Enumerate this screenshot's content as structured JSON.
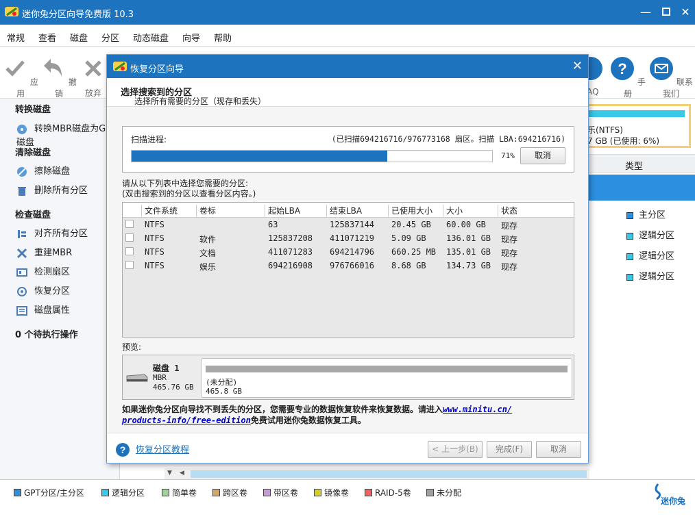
{
  "window": {
    "title": "迷你兔分区向导免费版 10.3"
  },
  "menu": [
    "常规",
    "查看",
    "磁盘",
    "分区",
    "动态磁盘",
    "向导",
    "帮助"
  ],
  "toolbar": {
    "apply": "应用",
    "undo": "撤销",
    "discard": "放弃",
    "faq": "FAQ",
    "manual": "手册",
    "contact": "联系我们"
  },
  "sidebar": {
    "convert_header": "转换磁盘",
    "convert_item": "转换MBR磁盘为GPT磁盘",
    "clean_header": "清除磁盘",
    "wipe": "擦除磁盘",
    "delete_all": "删除所有分区",
    "check_header": "检查磁盘",
    "align": "对齐所有分区",
    "rebuild_mbr": "重建MBR",
    "surface": "检测扇区",
    "recover": "恢复分区",
    "props": "磁盘属性",
    "pending": "0 个待执行操作"
  },
  "right": {
    "disk_label": "乐(NTFS)",
    "disk_usage": "7 GB (已使用: 6%)",
    "col_type": "类型",
    "types": [
      "主分区",
      "逻辑分区",
      "逻辑分区",
      "逻辑分区"
    ],
    "type_colors": [
      "#2d8fe0",
      "#38c8e8",
      "#38c8e8",
      "#38c8e8"
    ]
  },
  "dialog": {
    "title": "恢复分区向导",
    "heading": "选择搜索到的分区",
    "subheading": "选择所有需要的分区（现存和丢失）",
    "scan_label": "扫描进程:",
    "scan_status": "(已扫描694216716/976773168 扇区。扫描 LBA:694216716)",
    "progress": 0.71,
    "progress_text": "71%",
    "cancel_scan": "取消",
    "instruction1": "请从以下列表中选择您需要的分区:",
    "instruction2": "(双击搜索到的分区以查看分区内容。)",
    "columns": [
      "文件系统",
      "卷标",
      "起始LBA",
      "结束LBA",
      "已使用大小",
      "大小",
      "状态"
    ],
    "rows": [
      {
        "fs": "NTFS",
        "label": "",
        "start": "63",
        "end": "125837144",
        "used": "20.45 GB",
        "size": "60.00 GB",
        "status": "现存"
      },
      {
        "fs": "NTFS",
        "label": "软件",
        "start": "125837208",
        "end": "411071219",
        "used": "5.09 GB",
        "size": "136.01 GB",
        "status": "现存"
      },
      {
        "fs": "NTFS",
        "label": "文档",
        "start": "411071283",
        "end": "694214796",
        "used": "660.25 MB",
        "size": "135.01 GB",
        "status": "现存"
      },
      {
        "fs": "NTFS",
        "label": "娱乐",
        "start": "694216908",
        "end": "976766016",
        "used": "8.68 GB",
        "size": "134.73 GB",
        "status": "现存"
      }
    ],
    "preview_label": "预览:",
    "disk_name": "磁盘 1",
    "disk_type": "MBR",
    "disk_size": "465.76 GB",
    "seg_label": "(未分配)",
    "seg_size": "465.8 GB",
    "notice_text": "如果迷你兔分区向导找不到丢失的分区，您需要专业的数据恢复软件来恢复数据。请进入",
    "notice_link1": "www.minitu.cn/",
    "notice_link2": "products-info/free-edition",
    "notice_tail": "免费试用迷你兔数据恢复工具。",
    "tutorial": "恢复分区教程",
    "back": "< 上一步(B)",
    "finish": "完成(F)",
    "cancel": "取消"
  },
  "legend": [
    {
      "label": "GPT分区/主分区",
      "color": "#2d8fe0"
    },
    {
      "label": "逻辑分区",
      "color": "#38c8e8"
    },
    {
      "label": "简单卷",
      "color": "#9ed49a"
    },
    {
      "label": "跨区卷",
      "color": "#d2a868"
    },
    {
      "label": "带区卷",
      "color": "#c898d8"
    },
    {
      "label": "镜像卷",
      "color": "#d8d020"
    },
    {
      "label": "RAID-5卷",
      "color": "#f06060"
    },
    {
      "label": "未分配",
      "color": "#a0a0a0"
    }
  ],
  "brand": "迷你兔"
}
